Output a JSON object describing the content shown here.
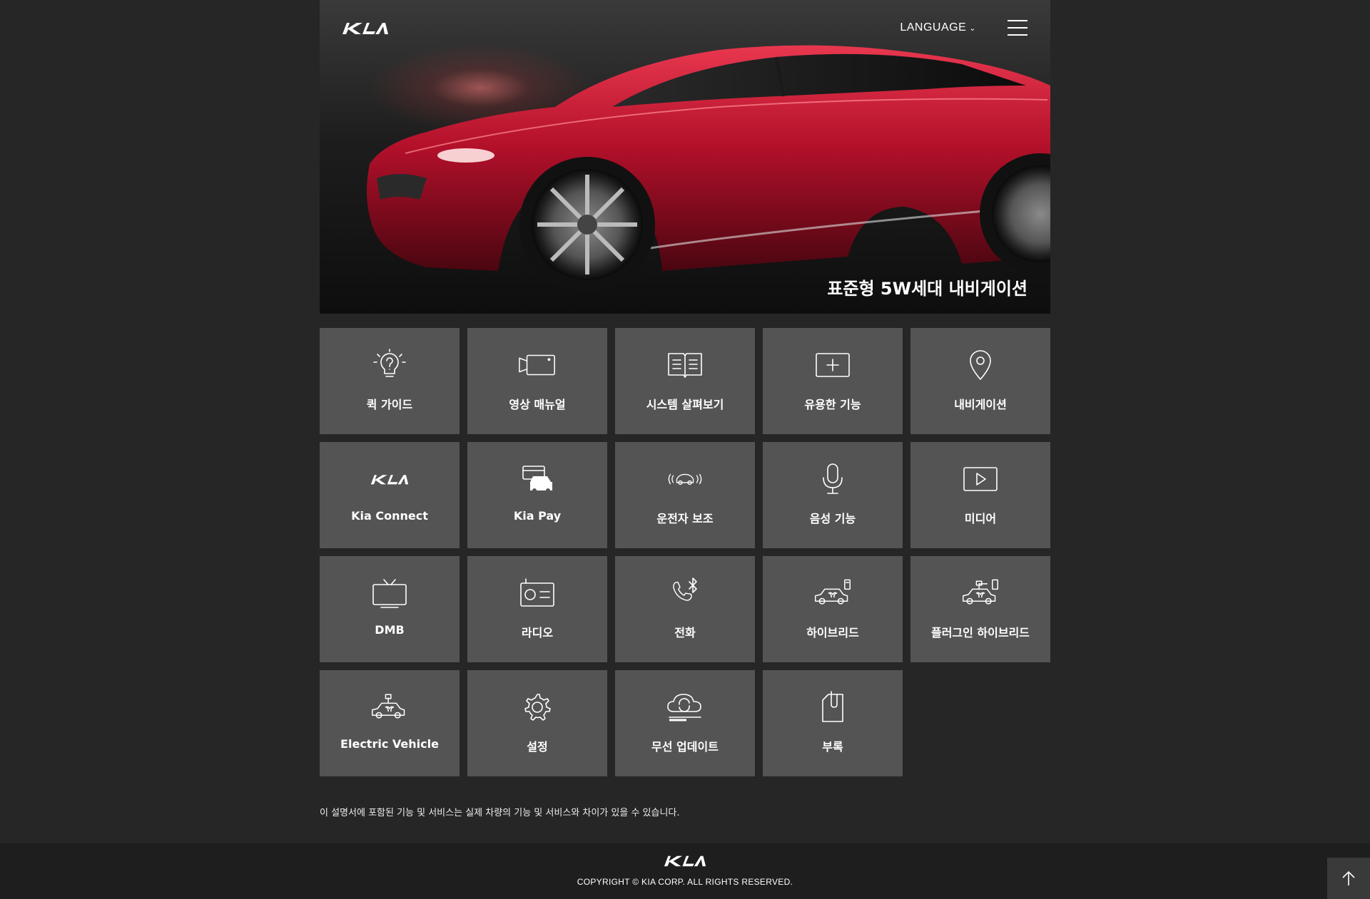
{
  "header": {
    "brand": "KIA",
    "language_label": "LANGUAGE",
    "title": "표준형 5W세대 내비게이션"
  },
  "menu": [
    {
      "label": "퀵 가이드",
      "icon": "lightbulb-question-icon"
    },
    {
      "label": "영상 매뉴얼",
      "icon": "video-camera-icon"
    },
    {
      "label": "시스템 살펴보기",
      "icon": "open-book-icon"
    },
    {
      "label": "유용한 기능",
      "icon": "plus-box-icon"
    },
    {
      "label": "내비게이션",
      "icon": "map-pin-icon"
    },
    {
      "label": "Kia Connect",
      "icon": "kia-logo-icon"
    },
    {
      "label": "Kia Pay",
      "icon": "card-car-icon"
    },
    {
      "label": "운전자 보조",
      "icon": "car-sensor-icon"
    },
    {
      "label": "음성 기능",
      "icon": "microphone-icon"
    },
    {
      "label": "미디어",
      "icon": "play-icon"
    },
    {
      "label": "DMB",
      "icon": "tv-icon"
    },
    {
      "label": "라디오",
      "icon": "radio-icon"
    },
    {
      "label": "전화",
      "icon": "phone-bluetooth-icon"
    },
    {
      "label": "하이브리드",
      "icon": "hybrid-car-icon"
    },
    {
      "label": "플러그인 하이브리드",
      "icon": "plugin-hybrid-car-icon"
    },
    {
      "label": "Electric Vehicle",
      "icon": "electric-car-icon"
    },
    {
      "label": "설정",
      "icon": "gear-icon"
    },
    {
      "label": "무선 업데이트",
      "icon": "cloud-update-icon"
    },
    {
      "label": "부록",
      "icon": "clip-document-icon"
    }
  ],
  "notice": "이 설명서에 포함된 기능 및 서비스는 실제 차량의 기능 및 서비스와 차이가 있을 수 있습니다.",
  "footer": {
    "brand": "KIA",
    "copyright": "COPYRIGHT © KIA CORP. ALL RIGHTS RESERVED."
  },
  "colors": {
    "background": "#262626",
    "tile": "#545454",
    "footer": "#1e1e1e",
    "car": "#c8102e"
  }
}
